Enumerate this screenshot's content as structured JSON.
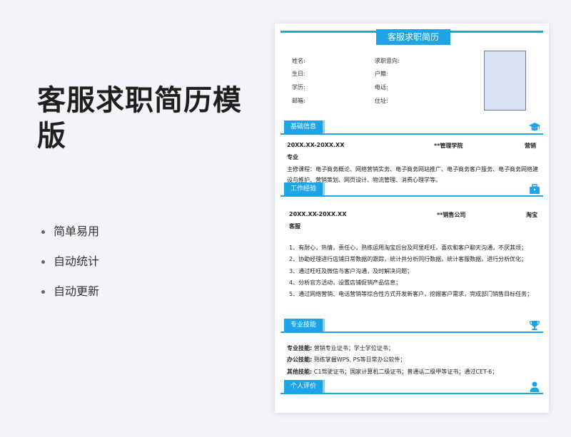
{
  "promo": {
    "title": "客服求职简历模版",
    "features": [
      "简单易用",
      "自动统计",
      "自动更新"
    ]
  },
  "resume": {
    "title": "客服求职简历",
    "fields": {
      "name": "姓名:",
      "intention": "求职意向:",
      "birth": "生日:",
      "household": "户籍:",
      "education": "学历:",
      "phone": "电话:",
      "email": "邮箱:",
      "address": "住址:"
    },
    "basic": {
      "heading": "基础信息",
      "period": "20XX.XX-20XX.XX",
      "school": "**管理学院",
      "major_a": "营销",
      "major_b": "专业",
      "courses": "主修课程：电子商务概论、网络营销实务、电子商务网站推广、电子商务客户服务、电子商务网络建设与推护、营销策划、网页设计、物流管理、消费心理学等。"
    },
    "work": {
      "heading": "工作经验",
      "period": "20XX.XX-20XX.XX",
      "company": "**销售公司",
      "position_a": "淘宝",
      "position_b": "客服",
      "duties": [
        "1、有耐心，热情，责任心，熟练运用淘宝后台及阿里旺旺，喜欢和客户聊天沟通，不厌其烦；",
        "2、协助经理进行店铺日常数据的跟踪，统计并分析同行数据，统计客服数据，进行分析优化；",
        "3、通过旺旺及微信与客户沟通，及时解决问题；",
        "4、分析官方活动，设置店铺促销产品信息；",
        "5、通过网络营销、电话营销等综合性方式开发新客户，挖掘客户需求，完成部门销售目标任务；"
      ]
    },
    "skills": {
      "heading": "专业技能",
      "items": [
        {
          "label": "专业技能:",
          "text": "营销专业证书；学士学位证书；"
        },
        {
          "label": "办公技能:",
          "text": "熟练掌握WPS, PS等日常办公软件；"
        },
        {
          "label": "其他技能:",
          "text": "C1驾驶证书；国家计算机二级证书；普通话二级甲等证书；通过CET-6；"
        }
      ]
    },
    "evaluation": {
      "heading": "个人评价"
    }
  },
  "colors": {
    "accent": "#1ea4e6",
    "photo_fill": "#d9e1f4"
  },
  "icons": [
    "graduation-cap-icon",
    "briefcase-icon",
    "trophy-icon",
    "person-icon"
  ]
}
